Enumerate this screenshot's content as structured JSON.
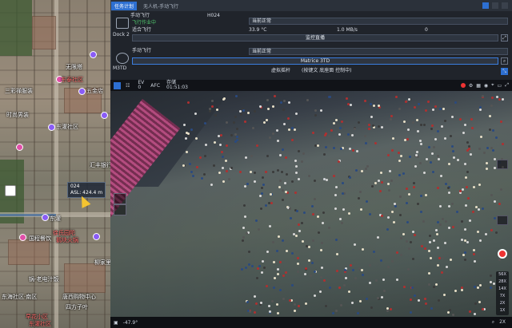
{
  "map": {
    "labels": [
      {
        "text": "无限塔",
        "red": false
      },
      {
        "text": "东泰社区",
        "red": false
      },
      {
        "text": "三彩禅服装",
        "red": false
      },
      {
        "text": "五金店",
        "red": false
      },
      {
        "text": "时尚男装",
        "red": false
      },
      {
        "text": "东灌社区",
        "red": false
      },
      {
        "text": "汇丰银行",
        "red": false
      },
      {
        "text": "东灌",
        "red": false
      },
      {
        "text": "国程餐饮",
        "red": false
      },
      {
        "text": "徐氏园陀",
        "red": false
      },
      {
        "text": "鹅块火锅",
        "red": false
      },
      {
        "text": "柳家里",
        "red": false
      },
      {
        "text": "锅-老电汁饭",
        "red": false
      },
      {
        "text": "东海社区·南区",
        "red": false
      },
      {
        "text": "唐西购物中心",
        "red": false
      },
      {
        "text": "四方子叶",
        "red": false
      },
      {
        "text": "早花小区",
        "red": true
      },
      {
        "text": "东灌社区",
        "red": true
      }
    ],
    "drone": {
      "name": "024",
      "asl": "ASL: 424.4 m"
    }
  },
  "panel": {
    "tab_active": "任务计划",
    "topbar_label": "无人机-手动飞行",
    "dock": {
      "name": "Dock 2",
      "mode": "手动飞行",
      "task_label": "飞行作业中",
      "aircraft_id": "H024",
      "status": "当前正常",
      "mode_value": "适合飞行",
      "temp": "33.9 °C",
      "network": "1.0 MB/s",
      "count": "0",
      "live_button": "监控直播"
    },
    "aircraft": {
      "name": "M3TD",
      "mode": "手动飞行",
      "status": "当前正常",
      "model_bar": "Matrice 3TD",
      "virtual_label": "虚拟摇杆",
      "virtual_hint": "(按键文 底座面 控制中)"
    }
  },
  "video": {
    "toolbar": {
      "ev_label": "EV",
      "ev_value": "0",
      "afc_label": "AFC",
      "storage_label": "存储",
      "storage_time": "01:51:03"
    },
    "bottom": {
      "pitch": "-47.9°",
      "zoom": "2X"
    },
    "zoom_levels": [
      "56X",
      "28X",
      "14X",
      "7X",
      "2X",
      "1X"
    ]
  },
  "colors": {
    "accent": "#2d6fd1",
    "record": "#e33333",
    "stage_led": "#c24e86",
    "drone_arrow": "#f4c430"
  }
}
